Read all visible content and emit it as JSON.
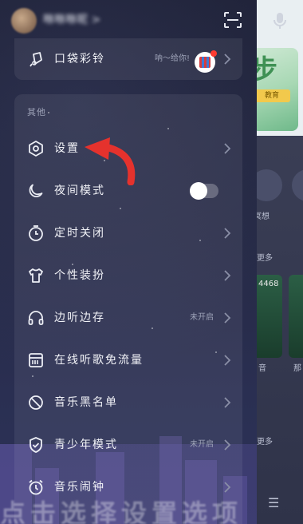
{
  "header": {
    "username": "咻咻咻呢 >",
    "scan_icon": "scan-icon"
  },
  "top_card": {
    "label": "口袋彩铃",
    "promo": "呐～给你!",
    "icon": "bell-hand-icon"
  },
  "section": {
    "label": "其他"
  },
  "menu": [
    {
      "label": "设置",
      "icon": "hexagon-gear-icon",
      "status": ""
    },
    {
      "label": "夜间模式",
      "icon": "moon-icon",
      "status": "",
      "toggle_on": false
    },
    {
      "label": "定时关闭",
      "icon": "timer-icon",
      "status": ""
    },
    {
      "label": "个性装扮",
      "icon": "tshirt-icon",
      "status": ""
    },
    {
      "label": "边听边存",
      "icon": "headphones-icon",
      "status": "未开启"
    },
    {
      "label": "在线听歌免流量",
      "icon": "sim-card-icon",
      "status": ""
    },
    {
      "label": "音乐黑名单",
      "icon": "block-icon",
      "status": ""
    },
    {
      "label": "青少年模式",
      "icon": "shield-check-icon",
      "status": "未开启"
    },
    {
      "label": "音乐闹钟",
      "icon": "alarm-clock-icon",
      "status": ""
    }
  ],
  "background_app": {
    "banner_text": "步",
    "banner_tag": "教育",
    "circle_label": "冥想",
    "more_1": "更多",
    "card_number": "4468",
    "card_label": "音",
    "card_label_2": "那",
    "more_2": "更多"
  },
  "overlay_caption": "点击选择设置选项",
  "colors": {
    "drawer_bg": "#252944",
    "card_bg": "rgba(255,255,255,0.07)",
    "text": "#f1f2f7",
    "secondary_text": "#9ea3b8",
    "arrow": "#e5322d"
  }
}
